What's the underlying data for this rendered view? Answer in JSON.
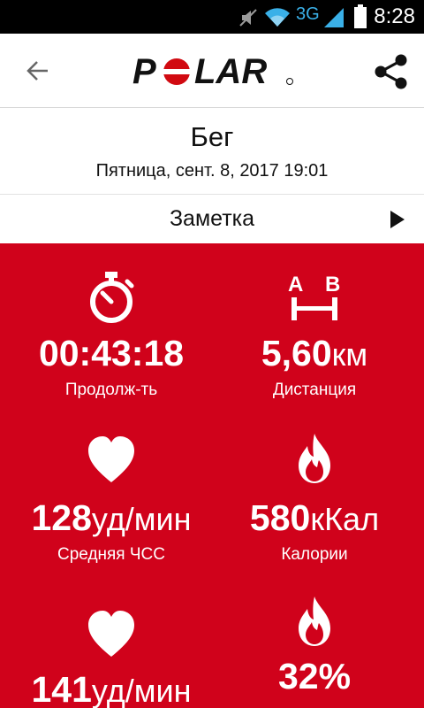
{
  "status_bar": {
    "time": "8:28",
    "network_type": "3G",
    "icons": [
      "mute-icon",
      "wifi-icon",
      "signal-icon",
      "battery-icon"
    ]
  },
  "header": {
    "logo_text": "POLAR",
    "back_icon": "arrow-left-icon",
    "share_icon": "share-icon"
  },
  "session": {
    "title": "Бег",
    "date": "Пятница, сент. 8, 2017 19:01"
  },
  "note": {
    "label": "Заметка",
    "arrow_icon": "play-arrow-icon"
  },
  "colors": {
    "brand_red": "#d0021b",
    "polar_logo_red": "#d10a11"
  },
  "stats": [
    {
      "icon": "stopwatch-icon",
      "value": "00:43:18",
      "unit": "",
      "label": "Продолж-ть"
    },
    {
      "icon": "distance-ab-icon",
      "value": "5,60",
      "unit": "км",
      "label": "Дистанция"
    },
    {
      "icon": "heart-icon",
      "value": "128",
      "unit": "уд/мин",
      "label": "Средняя ЧСС"
    },
    {
      "icon": "flame-icon",
      "value": "580",
      "unit": "кКал",
      "label": "Калории"
    },
    {
      "icon": "heart-icon",
      "value": "141",
      "unit": "уд/мин",
      "label": ""
    },
    {
      "icon": "flame-icon",
      "value": "32%",
      "unit": "",
      "label": ""
    }
  ]
}
